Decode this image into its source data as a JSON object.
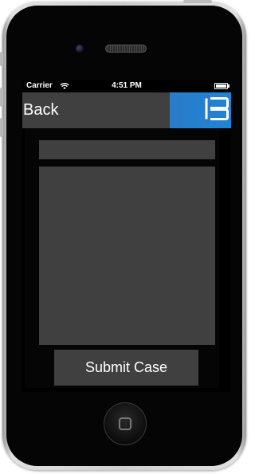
{
  "status_bar": {
    "carrier": "Carrier",
    "time": "4:51 PM"
  },
  "nav_bar": {
    "back_label": "Back",
    "logo_icon": "b-logo-icon",
    "logo_color": "#2a7cc8"
  },
  "form": {
    "subject_value": "",
    "description_value": "",
    "submit_label": "Submit Case"
  },
  "colors": {
    "field_bg": "#404040",
    "screen_bg": "#000000",
    "text": "#ffffff"
  }
}
